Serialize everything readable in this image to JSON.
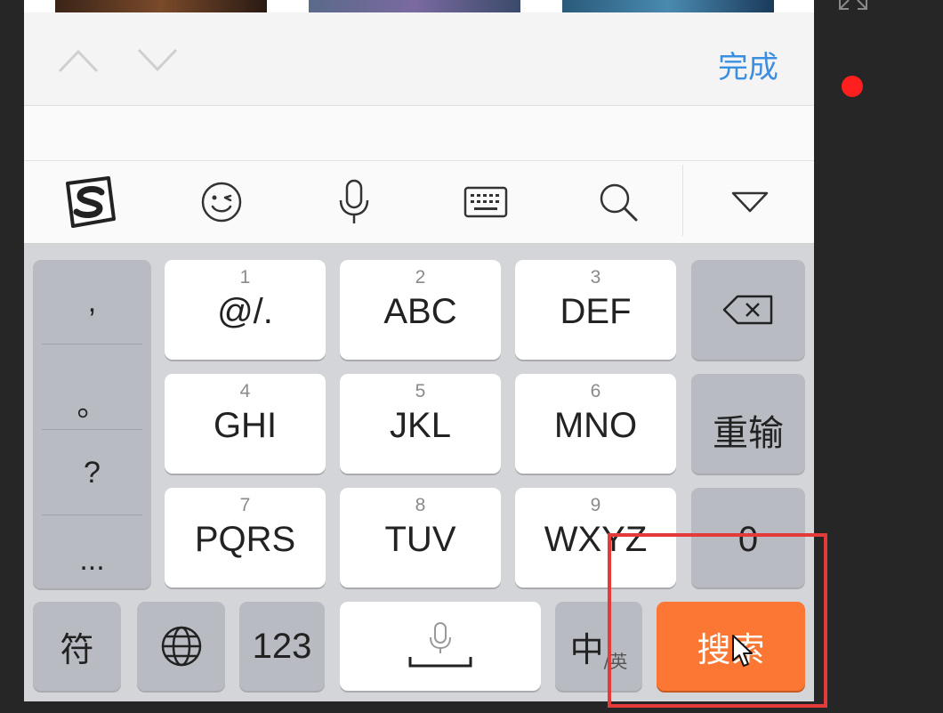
{
  "toolbar": {
    "prev_icon": "chevron-up-icon",
    "next_icon": "chevron-down-icon",
    "done_label": "完成",
    "accent_color": "#3b8fe0"
  },
  "ime_bar": {
    "icons": [
      "sogou-logo-icon",
      "emoji-icon",
      "microphone-icon",
      "keyboard-icon",
      "search-icon",
      "collapse-keyboard-icon"
    ]
  },
  "keyboard": {
    "punct": [
      ",",
      "。",
      "?",
      "..."
    ],
    "keys": [
      {
        "num": "1",
        "label": "@/."
      },
      {
        "num": "2",
        "label": "ABC"
      },
      {
        "num": "3",
        "label": "DEF"
      },
      {
        "num": "4",
        "label": "GHI"
      },
      {
        "num": "5",
        "label": "JKL"
      },
      {
        "num": "6",
        "label": "MNO"
      },
      {
        "num": "7",
        "label": "PQRS"
      },
      {
        "num": "8",
        "label": "TUV"
      },
      {
        "num": "9",
        "label": "WXYZ"
      }
    ],
    "backspace_icon": "backspace-icon",
    "reenter_label": "重输",
    "zero_label": "0",
    "symbols_label": "符",
    "globe_icon": "globe-icon",
    "numbers_label": "123",
    "space_icon": "microphone-icon",
    "lang_main": "中",
    "lang_sub": "/英",
    "search_label": "搜索",
    "search_color": "#fb7733"
  },
  "overlay": {
    "highlight_color": "#e53a3a",
    "record_color": "#ff1f1f"
  }
}
